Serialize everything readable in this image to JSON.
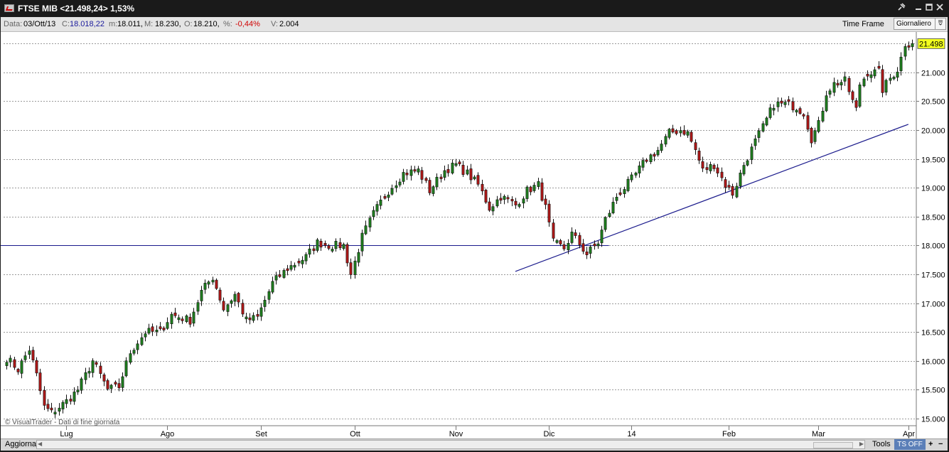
{
  "window": {
    "title": "FTSE MIB <21.498,24> 1,53%",
    "controls": [
      "pin-icon",
      "minimize-icon",
      "maximize-icon",
      "close-icon"
    ]
  },
  "infobar": {
    "date_label": "Data:",
    "date": "03/Ott/13",
    "close_label": "C:",
    "close": "18.018,22",
    "low_label": "m:",
    "low": "18.011,",
    "high_label": "M:",
    "high": "18.230,",
    "open_label": "O:",
    "open": "18.210,",
    "pct_label": "%:",
    "pct": "-0,44%",
    "volume_label": "V:",
    "volume": "2.004",
    "timeframe_label": "Time Frame",
    "timeframe_value": "Giornaliero"
  },
  "colors": {
    "up": "#1e7e1e",
    "down": "#b01818",
    "trend": "#1a1a8c",
    "grid": "#9a9a9a",
    "last_price_bg": "#f2ff1e",
    "titlebar": "#1a1a1a",
    "pct_negative": "#d00000",
    "close_value": "#1a1a9c"
  },
  "chart_data": {
    "type": "candlestick",
    "instrument": "FTSE MIB",
    "last_price_label": "21.498",
    "ylim": [
      14900,
      21700
    ],
    "y_ticks": [
      "15.000",
      "15.500",
      "16.000",
      "16.500",
      "17.000",
      "17.500",
      "18.000",
      "18.500",
      "19.000",
      "19.500",
      "20.000",
      "20.500",
      "21.000"
    ],
    "y_tick_values": [
      15000,
      15500,
      16000,
      16500,
      17000,
      17500,
      18000,
      18500,
      19000,
      19500,
      20000,
      20500,
      21000
    ],
    "x_labels": [
      "Lug",
      "Ago",
      "Set",
      "Ott",
      "Nov",
      "Dic",
      "14",
      "Feb",
      "Mar",
      "Apr"
    ],
    "x_label_bars": [
      16,
      43,
      68,
      93,
      120,
      145,
      167,
      193,
      217,
      241
    ],
    "bar_count": 243,
    "watermark": "© VisualTrader - Dati di fine giornata",
    "waypoints": [
      [
        0,
        16050
      ],
      [
        3,
        15850
      ],
      [
        6,
        16200
      ],
      [
        8,
        15750
      ],
      [
        10,
        15200
      ],
      [
        12,
        15100
      ],
      [
        16,
        15300
      ],
      [
        19,
        15500
      ],
      [
        23,
        16000
      ],
      [
        27,
        15500
      ],
      [
        30,
        15550
      ],
      [
        33,
        16150
      ],
      [
        37,
        16500
      ],
      [
        41,
        16500
      ],
      [
        44,
        16800
      ],
      [
        49,
        16700
      ],
      [
        52,
        17200
      ],
      [
        55,
        17450
      ],
      [
        58,
        16900
      ],
      [
        61,
        17150
      ],
      [
        64,
        16700
      ],
      [
        67,
        16750
      ],
      [
        71,
        17350
      ],
      [
        75,
        17600
      ],
      [
        80,
        17800
      ],
      [
        83,
        18050
      ],
      [
        86,
        18000
      ],
      [
        90,
        18000
      ],
      [
        92,
        17500
      ],
      [
        95,
        18150
      ],
      [
        98,
        18550
      ],
      [
        102,
        18950
      ],
      [
        106,
        19250
      ],
      [
        110,
        19300
      ],
      [
        113,
        18950
      ],
      [
        117,
        19300
      ],
      [
        120,
        19400
      ],
      [
        123,
        19250
      ],
      [
        126,
        19050
      ],
      [
        129,
        18650
      ],
      [
        132,
        18850
      ],
      [
        136,
        18700
      ],
      [
        139,
        18950
      ],
      [
        142,
        19050
      ],
      [
        144,
        18650
      ],
      [
        146,
        18050
      ],
      [
        149,
        17950
      ],
      [
        151,
        18200
      ],
      [
        155,
        17850
      ],
      [
        158,
        18050
      ],
      [
        160,
        18450
      ],
      [
        163,
        18850
      ],
      [
        167,
        19150
      ],
      [
        171,
        19500
      ],
      [
        174,
        19650
      ],
      [
        177,
        19950
      ],
      [
        180,
        20000
      ],
      [
        182,
        19950
      ],
      [
        184,
        19650
      ],
      [
        186,
        19300
      ],
      [
        189,
        19400
      ],
      [
        192,
        19050
      ],
      [
        194,
        18900
      ],
      [
        197,
        19400
      ],
      [
        200,
        19800
      ],
      [
        202,
        20050
      ],
      [
        205,
        20450
      ],
      [
        208,
        20450
      ],
      [
        211,
        20400
      ],
      [
        213,
        20300
      ],
      [
        215,
        19850
      ],
      [
        217,
        20100
      ],
      [
        219,
        20650
      ],
      [
        221,
        20800
      ],
      [
        224,
        20850
      ],
      [
        226,
        20500
      ],
      [
        227,
        20350
      ],
      [
        228,
        20800
      ],
      [
        230,
        21000
      ],
      [
        233,
        21000
      ],
      [
        234,
        20700
      ],
      [
        236,
        20900
      ],
      [
        238,
        21050
      ],
      [
        239,
        21250
      ],
      [
        240,
        21498
      ]
    ],
    "horizontal_line": {
      "value": 18000,
      "from_bar": 0,
      "to_bar": 161
    },
    "trendline": {
      "from": [
        136,
        17550
      ],
      "to": [
        241,
        20100
      ]
    }
  }
}
